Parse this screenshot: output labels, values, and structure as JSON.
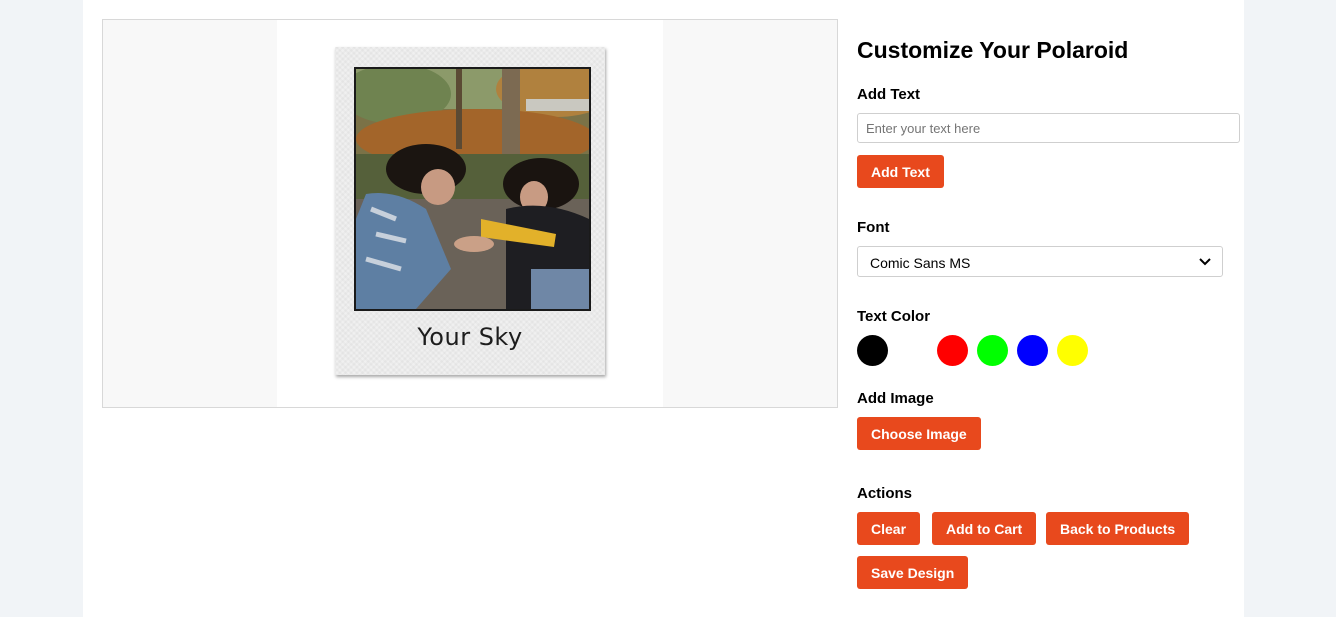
{
  "preview": {
    "caption": "Your Sky"
  },
  "panel": {
    "title": "Customize Your Polaroid",
    "add_text": {
      "label": "Add Text",
      "placeholder": "Enter your text here",
      "value": "",
      "button": "Add Text"
    },
    "font": {
      "label": "Font",
      "selected": "Comic Sans MS"
    },
    "text_color": {
      "label": "Text Color",
      "swatches": [
        {
          "name": "black",
          "color": "#000000"
        },
        {
          "name": "white",
          "color": "#ffffff"
        },
        {
          "name": "red",
          "color": "#ff0000"
        },
        {
          "name": "green",
          "color": "#00ff00"
        },
        {
          "name": "blue",
          "color": "#0000ff"
        },
        {
          "name": "yellow",
          "color": "#ffff00"
        }
      ]
    },
    "add_image": {
      "label": "Add Image",
      "button": "Choose Image"
    },
    "actions": {
      "label": "Actions",
      "clear": "Clear",
      "add_to_cart": "Add to Cart",
      "back_to_products": "Back to Products",
      "save_design": "Save Design"
    }
  },
  "colors": {
    "accent": "#e8491d",
    "page_background": "#f1f4f7"
  }
}
